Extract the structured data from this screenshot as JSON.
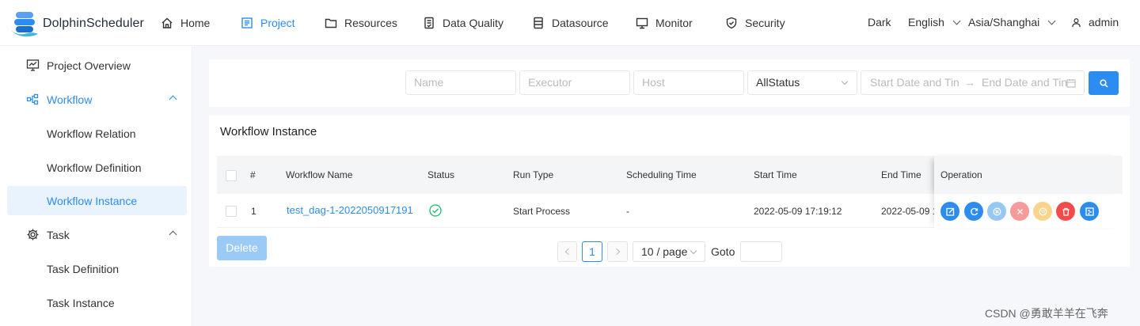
{
  "header": {
    "logo_text": "DolphinScheduler",
    "nav": [
      {
        "label": "Home",
        "icon": "home-icon"
      },
      {
        "label": "Project",
        "icon": "project-icon"
      },
      {
        "label": "Resources",
        "icon": "folder-icon"
      },
      {
        "label": "Data Quality",
        "icon": "data-quality-icon"
      },
      {
        "label": "Datasource",
        "icon": "database-icon"
      },
      {
        "label": "Monitor",
        "icon": "monitor-icon"
      },
      {
        "label": "Security",
        "icon": "shield-icon"
      }
    ],
    "theme": "Dark",
    "language": "English",
    "timezone": "Asia/Shanghai",
    "user": "admin"
  },
  "sidebar": {
    "items": [
      {
        "label": "Project Overview"
      },
      {
        "label": "Workflow"
      },
      {
        "label": "Workflow Relation"
      },
      {
        "label": "Workflow Definition"
      },
      {
        "label": "Workflow Instance"
      },
      {
        "label": "Task"
      },
      {
        "label": "Task Definition"
      },
      {
        "label": "Task Instance"
      }
    ]
  },
  "search": {
    "name_placeholder": "Name",
    "executor_placeholder": "Executor",
    "host_placeholder": "Host",
    "status_value": "AllStatus",
    "start_date_placeholder": "Start Date and Tin",
    "end_date_placeholder": "End Date and Tin"
  },
  "main": {
    "title": "Workflow Instance",
    "columns": [
      "#",
      "Workflow Name",
      "Status",
      "Run Type",
      "Scheduling Time",
      "Start Time",
      "End Time",
      "Operation"
    ],
    "rows": [
      {
        "index": "1",
        "workflow_name": "test_dag-1-2022050917191",
        "status": "success",
        "run_type": "Start Process",
        "scheduling_time": "-",
        "start_time": "2022-05-09 17:19:12",
        "end_time": "2022-05-09 1"
      }
    ],
    "delete_label": "Delete",
    "pagination": {
      "current_page": "1",
      "page_size": "10 / page",
      "goto_label": "Goto"
    }
  },
  "colors": {
    "primary": "#2d8cf0",
    "success": "#19be6b",
    "op_buttons": [
      "#2d8cf0",
      "#2d8cf0",
      "#96c8f4",
      "#f69a9a",
      "#f9d48a",
      "#f24b4b",
      "#2d8cf0"
    ]
  },
  "watermark": "CSDN @勇敢羊羊在飞奔"
}
